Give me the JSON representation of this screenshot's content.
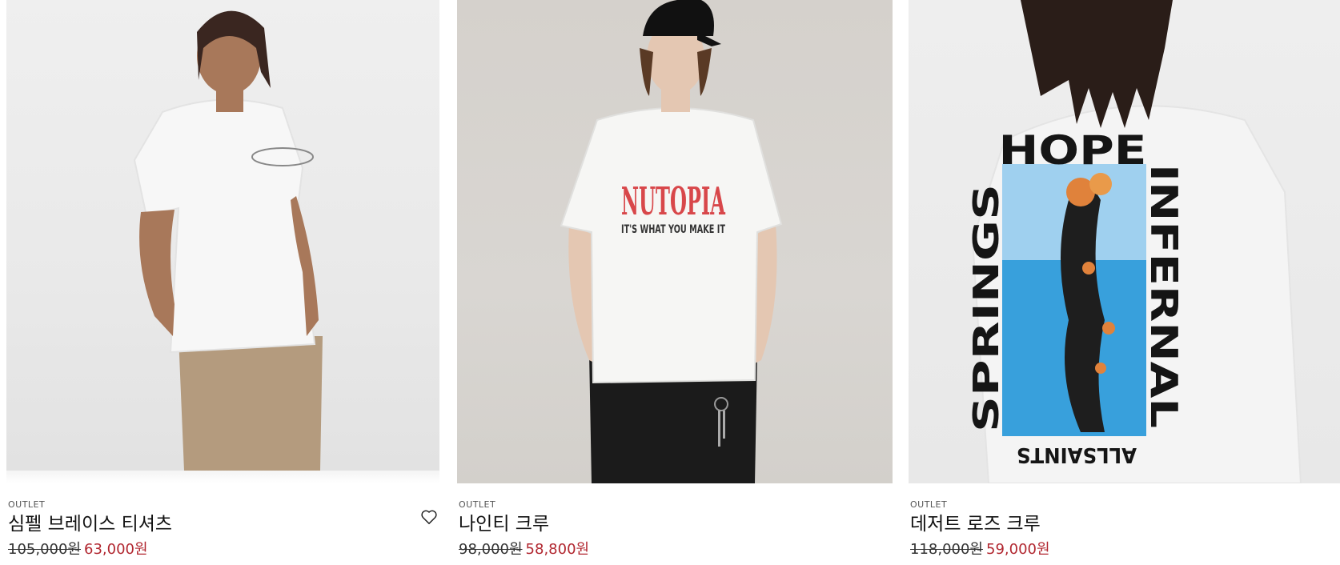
{
  "products": [
    {
      "badge": "OUTLET",
      "name": "심펠 브레이스 티셔츠",
      "price_original": "105,000원",
      "price_sale": "63,000원",
      "image_alt": "화이트 티셔츠를 입은 모델"
    },
    {
      "badge": "OUTLET",
      "name": "나인티 크루",
      "price_original": "98,000원",
      "price_sale": "58,800원",
      "print_title": "NUTOPIA",
      "print_sub": "IT'S WHAT YOU MAKE IT",
      "image_alt": "NUTOPIA 프린트 티셔츠를 입은 모델"
    },
    {
      "badge": "OUTLET",
      "name": "데저트 로즈 크루",
      "price_original": "118,000원",
      "price_sale": "59,000원",
      "print_top": "HOPE",
      "print_right": "INFERNAL",
      "print_left": "SPRINGS",
      "print_bottom": "ALLSAINTS",
      "image_alt": "백 프린트 롱슬리브를 입은 모델"
    }
  ],
  "wishlist_icon": "heart-outline-icon",
  "colors": {
    "sale": "#b1262f",
    "text": "#111111"
  }
}
